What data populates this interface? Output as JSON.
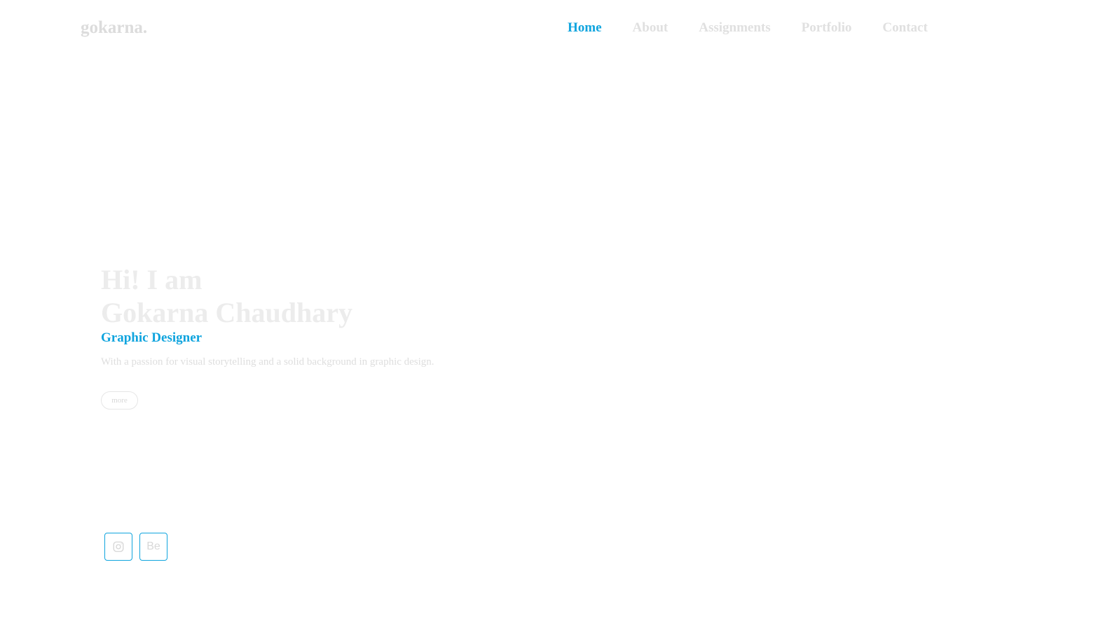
{
  "header": {
    "logo": "gokarna.",
    "nav": [
      {
        "label": "Home",
        "active": true
      },
      {
        "label": "About",
        "active": false
      },
      {
        "label": "Assignments",
        "active": false
      },
      {
        "label": "Portfolio",
        "active": false
      },
      {
        "label": "Contact",
        "active": false
      }
    ]
  },
  "hero": {
    "greeting": "Hi! I am",
    "name": "Gokarna Chaudhary",
    "role": "Graphic Designer",
    "description": "With a passion for visual storytelling and a solid background in graphic design.",
    "more_label": "more"
  },
  "social": {
    "instagram_icon": "instagram-icon",
    "behance_label": "Be"
  },
  "colors": {
    "accent": "#0fa4de",
    "muted_text": "#e0e0e0",
    "background": "#ffffff"
  }
}
